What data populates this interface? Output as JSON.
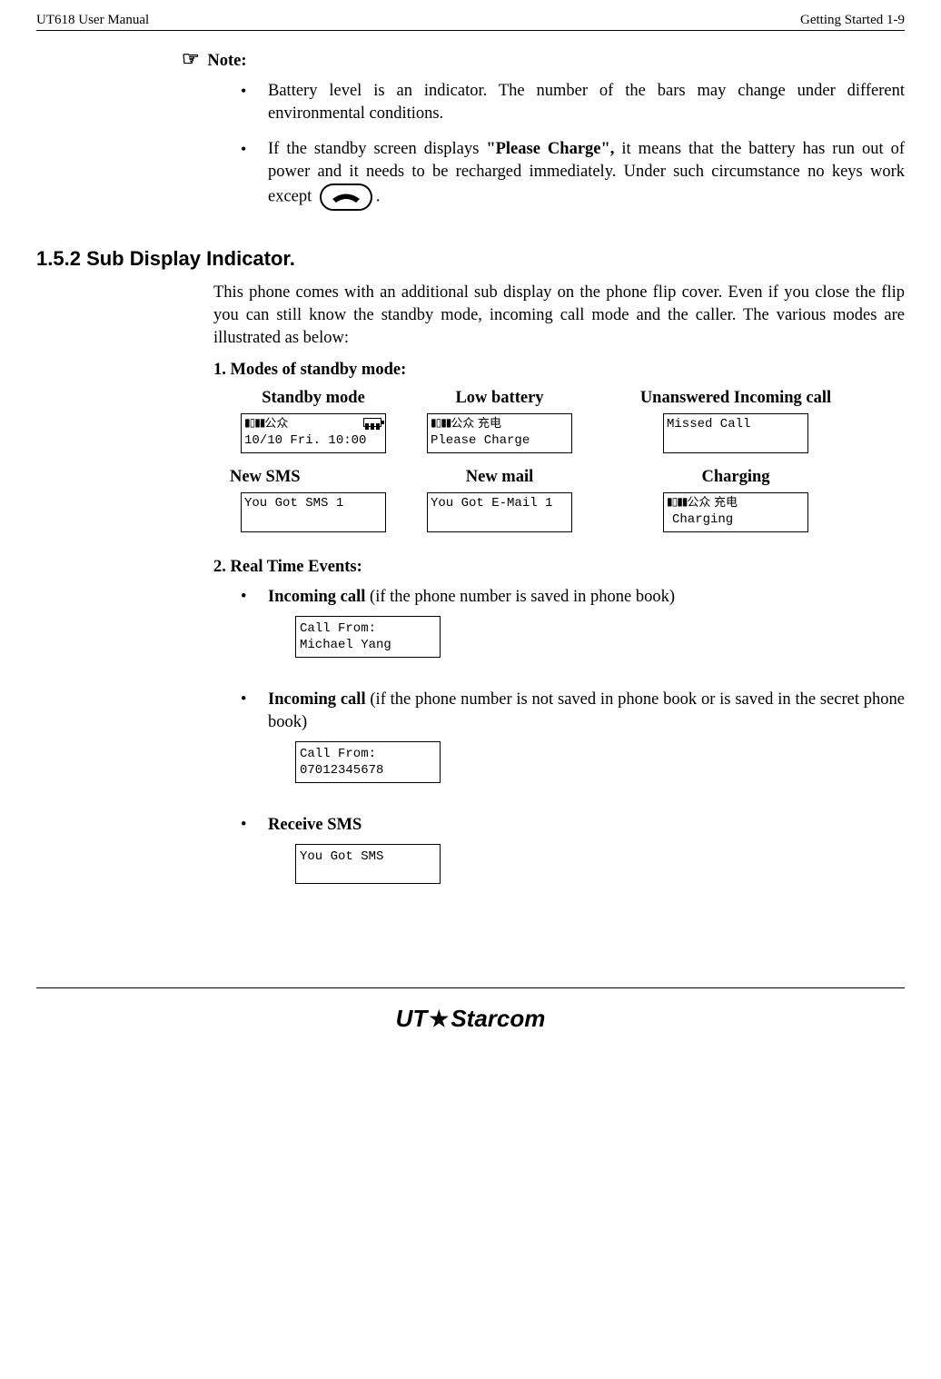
{
  "header": {
    "left": "UT618 User Manual",
    "right": "Getting Started   1-9"
  },
  "note": {
    "symbol": "☞",
    "label": "Note:",
    "bullets": [
      "Battery level is an indicator. The number of the bars may change under different environmental conditions.",
      {
        "pre": "If the standby screen displays ",
        "bold": "\"Please Charge\",",
        "post": " it means that the battery has run out of power and it needs to be recharged immediately. Under such circumstance no keys work except ",
        "tail": "."
      }
    ]
  },
  "section": {
    "number": "1.5.2",
    "title": "Sub Display Indicator."
  },
  "intro": "This phone comes with an additional sub display on the phone flip cover. Even if you close the flip you can still know the standby mode, incoming call mode and the caller.  The various modes are illustrated as below:",
  "modes": {
    "heading": "1.   Modes of standby mode:",
    "items": [
      {
        "label": "Standby mode",
        "lines": [
          "公众",
          "10/10 Fri. 10:00"
        ],
        "signal": true,
        "battery": true
      },
      {
        "label": "Low battery",
        "lines": [
          "公众    充电",
          "Please Charge"
        ],
        "signal": true
      },
      {
        "label": "Unanswered Incoming call",
        "lines": [
          "Missed Call",
          ""
        ]
      },
      {
        "label": "New SMS",
        "lines": [
          "You Got SMS   1",
          ""
        ]
      },
      {
        "label": "New mail",
        "lines": [
          "You Got E-Mail 1",
          ""
        ]
      },
      {
        "label": "Charging",
        "lines": [
          "公众    充电",
          "Charging"
        ],
        "signal": true
      }
    ]
  },
  "realtime": {
    "heading": "2.   Real Time Events:",
    "items": [
      {
        "pre": "",
        "bold": "Incoming call",
        "post": " (if the phone number is saved in phone book)",
        "display": [
          "Call From:",
          "Michael Yang"
        ]
      },
      {
        "pre": "",
        "bold": "Incoming call",
        "post": " (if the phone number is not saved in phone book or is saved in the secret phone book)",
        "display": [
          "Call From:",
          "07012345678"
        ]
      },
      {
        "pre": "",
        "bold": "Receive SMS",
        "post": "",
        "display": [
          "You Got SMS",
          ""
        ]
      }
    ]
  },
  "footer": {
    "logo_left": "UT",
    "logo_right": "Starcom"
  }
}
